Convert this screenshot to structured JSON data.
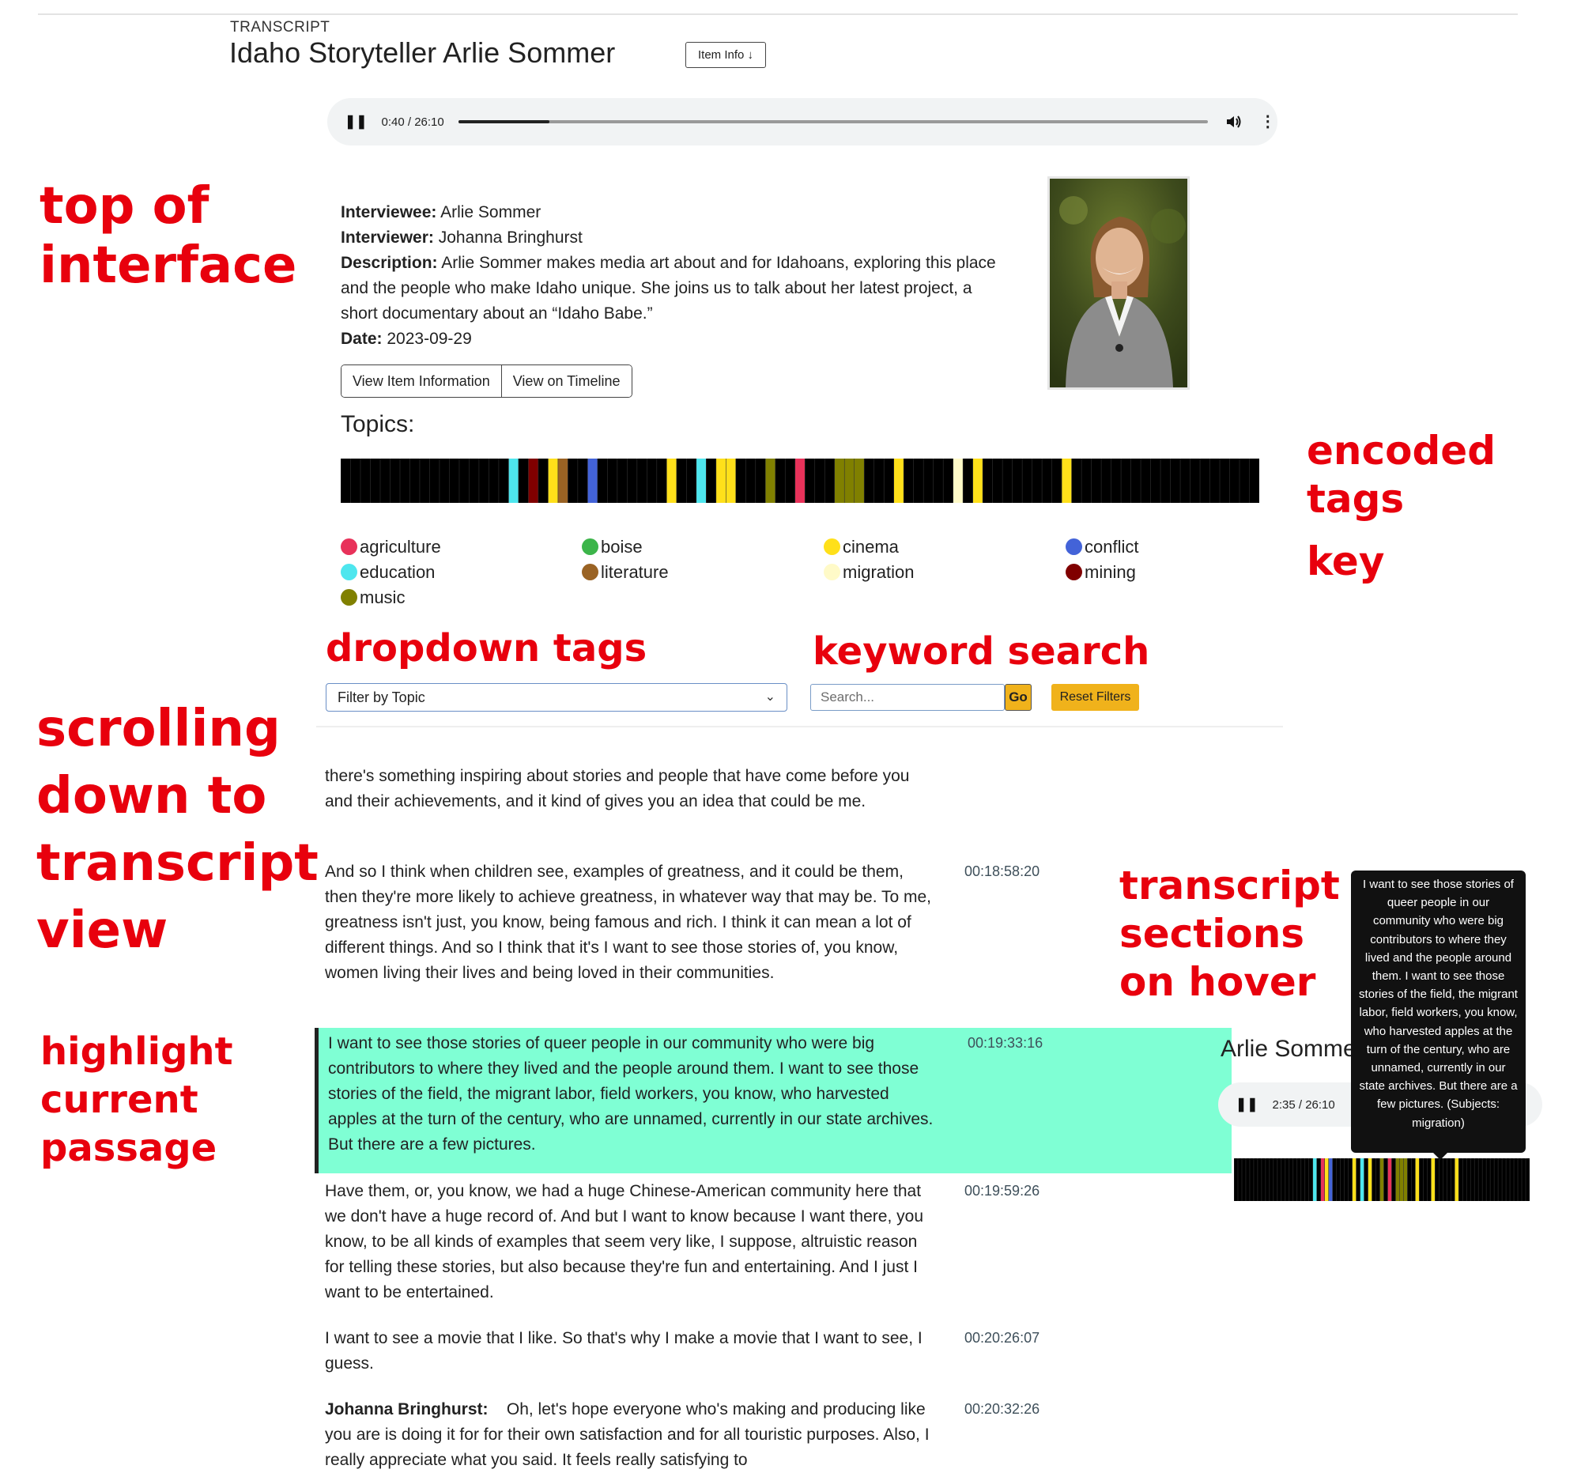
{
  "header": {
    "kicker": "TRANSCRIPT",
    "title": "Idaho Storyteller Arlie Sommer",
    "item_info_label": "Item Info ↓"
  },
  "player": {
    "time": "0:40 / 26:10",
    "progress": 0.0255
  },
  "annotations": {
    "top_1": "top of",
    "top_2": "interface",
    "enc_1": "encoded",
    "enc_2": "tags",
    "enc_3": "key",
    "dropdown": "dropdown tags",
    "keyword": "keyword search",
    "scroll_1": "scrolling",
    "scroll_2": "down to",
    "scroll_3": "transcript",
    "scroll_4": "view",
    "hl_1": "highlight",
    "hl_2": "current",
    "hl_3": "passage",
    "hover_1": "transcript",
    "hover_2": "sections",
    "hover_3": "on hover"
  },
  "metadata": {
    "interviewee_label": "Interviewee:",
    "interviewee": "Arlie Sommer",
    "interviewer_label": "Interviewer:",
    "interviewer": "Johanna Bringhurst",
    "description_label": "Description:",
    "description": "Arlie Sommer makes media art about and for Idahoans, exploring this place and the people who make Idaho unique. She joins us to talk about her latest project, a short documentary about an “Idaho Babe.”",
    "date_label": "Date:",
    "date": "2023-09-29"
  },
  "buttons": {
    "view_item": "View Item Information",
    "view_timeline": "View on Timeline"
  },
  "topics_label": "Topics:",
  "legend": [
    {
      "label": "agriculture",
      "color": "#e8325a"
    },
    {
      "label": "boise",
      "color": "#3cb54a"
    },
    {
      "label": "cinema",
      "color": "#ffe01a"
    },
    {
      "label": "conflict",
      "color": "#4363d8"
    },
    {
      "label": "education",
      "color": "#4ee6ee"
    },
    {
      "label": "literature",
      "color": "#9a6324"
    },
    {
      "label": "migration",
      "color": "#fffac8"
    },
    {
      "label": "mining",
      "color": "#800000"
    },
    {
      "label": "music",
      "color": "#808000"
    }
  ],
  "topic_strip": [
    "#000000",
    "#000000",
    "#000000",
    "#000000",
    "#000000",
    "#000000",
    "#000000",
    "#000000",
    "#000000",
    "#000000",
    "#000000",
    "#000000",
    "#000000",
    "#000000",
    "#000000",
    "#000000",
    "#000000",
    "#4ee6ee",
    "#000000",
    "#800000",
    "#000000",
    "#ffe01a",
    "#9a6324",
    "#000000",
    "#000000",
    "#4363d8",
    "#000000",
    "#000000",
    "#000000",
    "#000000",
    "#000000",
    "#000000",
    "#000000",
    "#ffe01a",
    "#000000",
    "#000000",
    "#4ee6ee",
    "#000000",
    "#ffe01a",
    "#ffe01a",
    "#000000",
    "#000000",
    "#000000",
    "#808000",
    "#000000",
    "#000000",
    "#e8325a",
    "#000000",
    "#000000",
    "#000000",
    "#808000",
    "#808000",
    "#808000",
    "#000000",
    "#000000",
    "#000000",
    "#ffe01a",
    "#000000",
    "#000000",
    "#000000",
    "#000000",
    "#000000",
    "#fffac8",
    "#000000",
    "#ffe01a",
    "#000000",
    "#000000",
    "#000000",
    "#000000",
    "#000000",
    "#000000",
    "#000000",
    "#000000",
    "#ffe01a",
    "#000000",
    "#000000",
    "#000000",
    "#000000",
    "#000000",
    "#000000",
    "#000000",
    "#000000",
    "#000000",
    "#000000",
    "#000000",
    "#000000",
    "#000000",
    "#000000",
    "#000000",
    "#000000",
    "#000000",
    "#000000",
    "#000000"
  ],
  "filters": {
    "topic_placeholder": "Filter by Topic",
    "search_placeholder": "Search...",
    "go_label": "Go",
    "reset_label": "Reset Filters"
  },
  "transcript": [
    {
      "text": "there's something inspiring about stories and people that have come before you and their achievements, and it kind of gives you an idea that could be me.",
      "time": ""
    },
    {
      "text": "And so I think when children see, examples of greatness, and it could be them, then they're more likely to achieve greatness, in whatever way that may be. To me, greatness isn't just, you know, being famous and rich. I think it can mean a lot of different things. And so I think that it's I want to see those stories of, you know, women living their lives and being loved in their communities.",
      "time": "00:18:58:20"
    },
    {
      "text": "I want to see those stories of queer people in our community who were big contributors to where they lived and the people around them. I want to see those stories of the field, the migrant labor, field workers, you know, who harvested apples at the turn of the century, who are unnamed, currently in our state archives. But there are a few pictures.",
      "time": "00:19:33:16"
    },
    {
      "text": "Have them, or, you know, we had a huge Chinese-American community here that we don't have a huge record of. And but I want to know because I want there, you know, to be all kinds of examples that seem very like, I suppose, altruistic reason for telling these stories, but also because they're fun and entertaining. And I just I want to be entertained.",
      "time": "00:19:59:26"
    },
    {
      "text": "I want to see a movie that I like. So that's why I make a movie that I want to see, I guess.",
      "time": "00:20:26:07"
    },
    {
      "speaker": "Johanna Bringhurst:",
      "text": "Oh, let's hope everyone who's making and producing like you are is doing it for for their own satisfaction and for all touristic purposes. Also, I really appreciate what you said. It feels really satisfying to",
      "time": "00:20:32:26"
    }
  ],
  "mini_view": {
    "title": "Arlie Sommer",
    "time": "2:35 / 26:10",
    "tooltip": "I want to see those stories of queer people in our community who were big contributors to where they lived and the people around them. I want to see those stories of the field, the migrant labor, field workers, you know, who harvested apples at the turn of the century, who are unnamed, currently in our state archives. But there are a few pictures. (Subjects: migration)"
  },
  "mini_strip": [
    "#000000",
    "#000000",
    "#000000",
    "#000000",
    "#000000",
    "#000000",
    "#000000",
    "#000000",
    "#000000",
    "#000000",
    "#000000",
    "#000000",
    "#000000",
    "#000000",
    "#000000",
    "#000000",
    "#000000",
    "#000000",
    "#000000",
    "#000000",
    "#4ee6ee",
    "#000000",
    "#e8325a",
    "#ffe01a",
    "#4363d8",
    "#000000",
    "#000000",
    "#000000",
    "#000000",
    "#000000",
    "#ffe01a",
    "#000000",
    "#4ee6ee",
    "#000000",
    "#ffe01a",
    "#000000",
    "#000000",
    "#808000",
    "#000000",
    "#e8325a",
    "#000000",
    "#808000",
    "#808000",
    "#808000",
    "#000000",
    "#000000",
    "#ffe01a",
    "#000000",
    "#000000",
    "#000000",
    "#ffe01a",
    "#000000",
    "#000000",
    "#000000",
    "#000000",
    "#000000",
    "#ffe01a",
    "#000000",
    "#000000",
    "#000000",
    "#000000",
    "#000000",
    "#000000",
    "#000000",
    "#000000",
    "#000000",
    "#000000",
    "#000000",
    "#000000",
    "#000000",
    "#000000",
    "#000000",
    "#000000",
    "#000000",
    "#000000"
  ]
}
